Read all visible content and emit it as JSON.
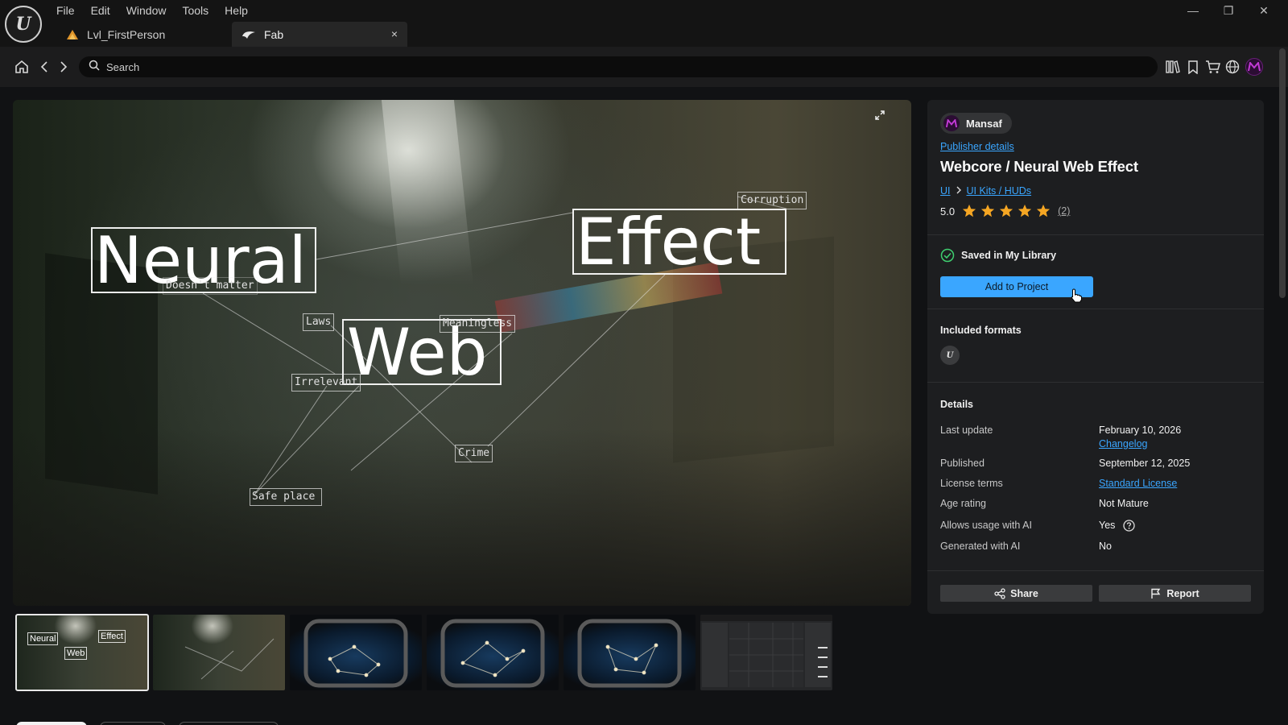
{
  "titlebar": {
    "menu": [
      "File",
      "Edit",
      "Window",
      "Tools",
      "Help"
    ],
    "tabs": [
      {
        "label": "Lvl_FirstPerson"
      },
      {
        "label": "Fab"
      }
    ],
    "tab_close": "×",
    "window_controls": {
      "minimize": "—",
      "restore": "❐",
      "close": "✕"
    }
  },
  "toolbar": {
    "search_placeholder": "Search"
  },
  "hero": {
    "words": {
      "neural": "Neural",
      "effect": "Effect",
      "web": "Web"
    },
    "tags": {
      "corruption": "Corruption",
      "doesnt_matter": "Doesn't matter",
      "laws": "Laws",
      "meaningless": "Meaningless",
      "irrelevant": "Irrelevant",
      "crime": "Crime",
      "safe_place": "Safe place"
    }
  },
  "thumbnails": {
    "first": {
      "neural": "Neural",
      "effect": "Effect",
      "web": "Web"
    }
  },
  "panel": {
    "publisher_name": "Mansaf",
    "publisher_link": "Publisher details",
    "title": "Webcore / Neural Web Effect",
    "breadcrumb": [
      "UI",
      "UI Kits / HUDs"
    ],
    "rating": "5.0",
    "stars": 5,
    "rating_count": "(2)",
    "saved_label": "Saved in My Library",
    "add_button": "Add to Project",
    "formats_title": "Included formats",
    "details_title": "Details",
    "details": {
      "last_update_label": "Last update",
      "last_update_value": "February 10, 2026",
      "changelog": "Changelog",
      "published_label": "Published",
      "published_value": "September 12, 2025",
      "license_label": "License terms",
      "license_value": "Standard License",
      "age_label": "Age rating",
      "age_value": "Not Mature",
      "ai_usage_label": "Allows usage with AI",
      "ai_usage_value": "Yes",
      "ai_generated_label": "Generated with AI",
      "ai_generated_value": "No"
    },
    "share_button": "Share",
    "report_button": "Report"
  },
  "colors": {
    "accent": "#3aa6ff",
    "star": "#f5a623",
    "saved_check": "#3ecf6f"
  }
}
